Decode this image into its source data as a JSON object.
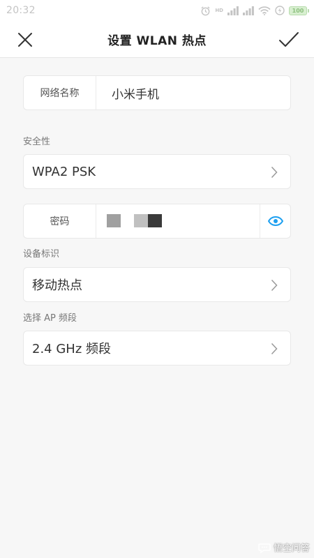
{
  "status_bar": {
    "time": "20:32",
    "signal_label": "HD",
    "battery_label": "100"
  },
  "header": {
    "title": "设置 WLAN 热点"
  },
  "network_name": {
    "label": "网络名称",
    "value": "小米手机"
  },
  "security": {
    "section_label": "安全性",
    "value": "WPA2 PSK"
  },
  "password": {
    "label": "密码"
  },
  "device_id": {
    "section_label": "设备标识",
    "value": "移动热点"
  },
  "ap_band": {
    "section_label": "选择 AP 频段",
    "value": "2.4 GHz 频段"
  },
  "watermark": {
    "text": "悟空问答"
  },
  "colors": {
    "accent": "#1ea0f0",
    "background": "#f7f7f7",
    "card": "#ffffff"
  }
}
